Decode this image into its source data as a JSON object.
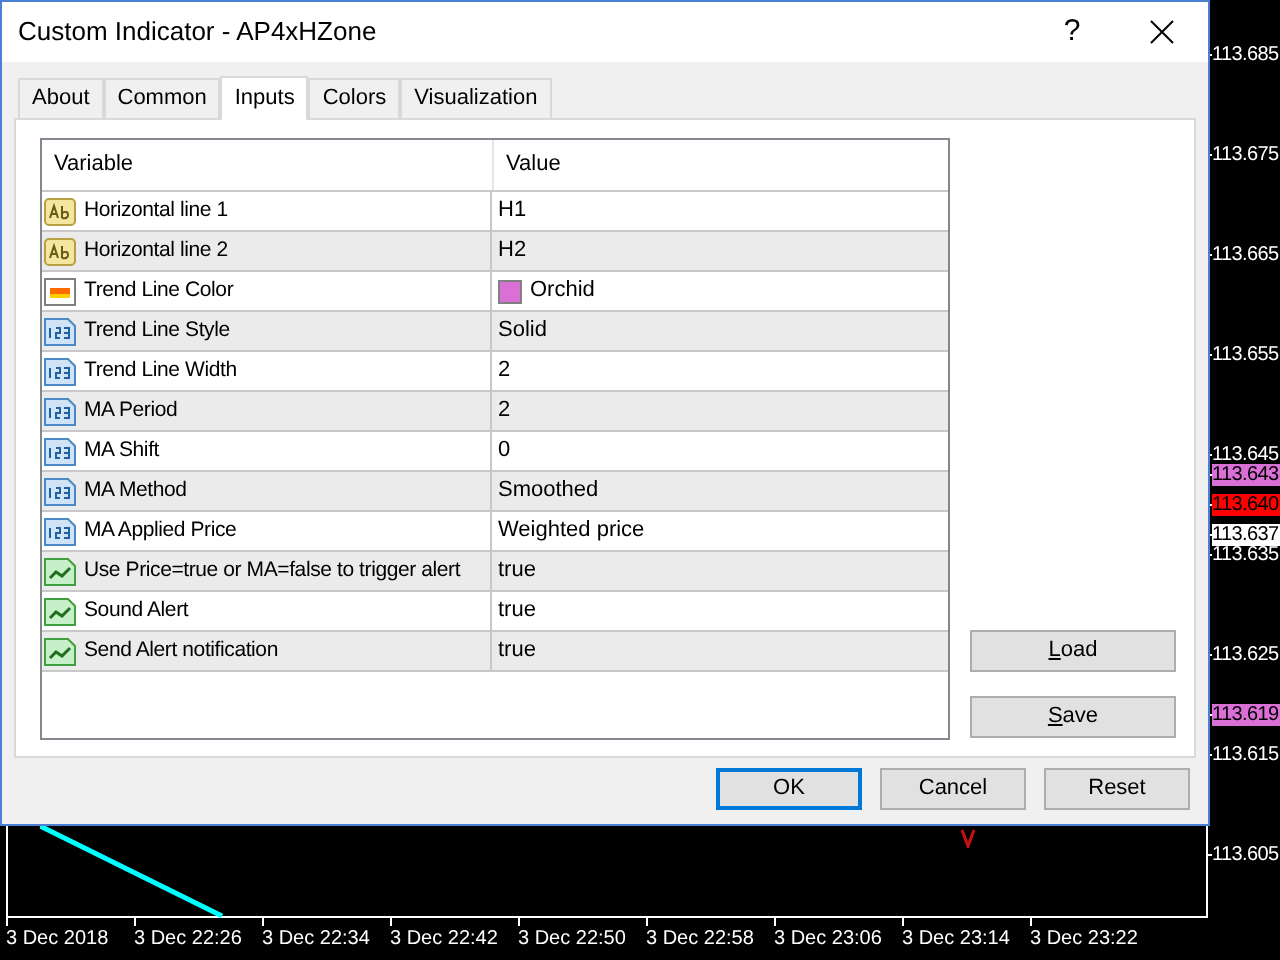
{
  "window": {
    "title": "Custom Indicator - AP4xHZone",
    "help": "?"
  },
  "tabs": [
    {
      "label": "About",
      "selected": false
    },
    {
      "label": "Common",
      "selected": false
    },
    {
      "label": "Inputs",
      "selected": true
    },
    {
      "label": "Colors",
      "selected": false
    },
    {
      "label": "Visualization",
      "selected": false
    }
  ],
  "table": {
    "columns": [
      "Variable",
      "Value"
    ],
    "rows": [
      {
        "kind": "string",
        "variable": "Horizontal line 1",
        "value": "H1"
      },
      {
        "kind": "string",
        "variable": "Horizontal line 2",
        "value": "H2"
      },
      {
        "kind": "color",
        "variable": "Trend Line Color",
        "value": "Orchid",
        "color": "#da70d6"
      },
      {
        "kind": "number",
        "variable": "Trend Line Style",
        "value": "Solid"
      },
      {
        "kind": "number",
        "variable": "Trend Line Width",
        "value": "2"
      },
      {
        "kind": "number",
        "variable": "MA Period",
        "value": "2"
      },
      {
        "kind": "number",
        "variable": "MA Shift",
        "value": "0"
      },
      {
        "kind": "number",
        "variable": "MA Method",
        "value": "Smoothed"
      },
      {
        "kind": "number",
        "variable": "MA Applied Price",
        "value": "Weighted price"
      },
      {
        "kind": "bool",
        "variable": "Use Price=true or MA=false to trigger alert",
        "value": "true"
      },
      {
        "kind": "bool",
        "variable": "Sound Alert",
        "value": "true"
      },
      {
        "kind": "bool",
        "variable": "Send Alert notification",
        "value": "true"
      }
    ]
  },
  "side_buttons": [
    {
      "label": "Load",
      "access_key": true
    },
    {
      "label": "Save",
      "access_key": true
    }
  ],
  "footer_buttons": [
    {
      "label": "OK",
      "default": true
    },
    {
      "label": "Cancel",
      "default": false
    },
    {
      "label": "Reset",
      "default": false
    }
  ],
  "price_axis": [
    {
      "label": "113.685"
    },
    {
      "label": "113.675"
    },
    {
      "label": "113.665"
    },
    {
      "label": "113.655"
    },
    {
      "label": "113.645"
    },
    {
      "label": "113.643",
      "color": "#da70d6"
    },
    {
      "label": "113.640",
      "color": "#ff0000"
    },
    {
      "label": "113.637",
      "color": "#ffffff"
    },
    {
      "label": "113.635"
    },
    {
      "label": "113.625"
    },
    {
      "label": "113.619",
      "color": "#da70d6"
    },
    {
      "label": "113.615"
    },
    {
      "label": "113.605"
    }
  ],
  "time_axis": [
    "3 Dec 2018",
    "3 Dec 22:26",
    "3 Dec 22:34",
    "3 Dec 22:42",
    "3 Dec 22:50",
    "3 Dec 22:58",
    "3 Dec 23:06",
    "3 Dec 23:14",
    "3 Dec 23:22"
  ]
}
